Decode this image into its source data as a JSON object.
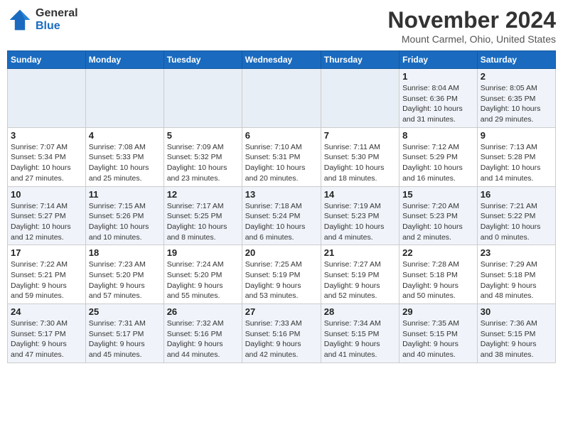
{
  "header": {
    "logo_line1": "General",
    "logo_line2": "Blue",
    "month": "November 2024",
    "location": "Mount Carmel, Ohio, United States"
  },
  "weekdays": [
    "Sunday",
    "Monday",
    "Tuesday",
    "Wednesday",
    "Thursday",
    "Friday",
    "Saturday"
  ],
  "weeks": [
    [
      {
        "day": "",
        "info": ""
      },
      {
        "day": "",
        "info": ""
      },
      {
        "day": "",
        "info": ""
      },
      {
        "day": "",
        "info": ""
      },
      {
        "day": "",
        "info": ""
      },
      {
        "day": "1",
        "info": "Sunrise: 8:04 AM\nSunset: 6:36 PM\nDaylight: 10 hours\nand 31 minutes."
      },
      {
        "day": "2",
        "info": "Sunrise: 8:05 AM\nSunset: 6:35 PM\nDaylight: 10 hours\nand 29 minutes."
      }
    ],
    [
      {
        "day": "3",
        "info": "Sunrise: 7:07 AM\nSunset: 5:34 PM\nDaylight: 10 hours\nand 27 minutes."
      },
      {
        "day": "4",
        "info": "Sunrise: 7:08 AM\nSunset: 5:33 PM\nDaylight: 10 hours\nand 25 minutes."
      },
      {
        "day": "5",
        "info": "Sunrise: 7:09 AM\nSunset: 5:32 PM\nDaylight: 10 hours\nand 23 minutes."
      },
      {
        "day": "6",
        "info": "Sunrise: 7:10 AM\nSunset: 5:31 PM\nDaylight: 10 hours\nand 20 minutes."
      },
      {
        "day": "7",
        "info": "Sunrise: 7:11 AM\nSunset: 5:30 PM\nDaylight: 10 hours\nand 18 minutes."
      },
      {
        "day": "8",
        "info": "Sunrise: 7:12 AM\nSunset: 5:29 PM\nDaylight: 10 hours\nand 16 minutes."
      },
      {
        "day": "9",
        "info": "Sunrise: 7:13 AM\nSunset: 5:28 PM\nDaylight: 10 hours\nand 14 minutes."
      }
    ],
    [
      {
        "day": "10",
        "info": "Sunrise: 7:14 AM\nSunset: 5:27 PM\nDaylight: 10 hours\nand 12 minutes."
      },
      {
        "day": "11",
        "info": "Sunrise: 7:15 AM\nSunset: 5:26 PM\nDaylight: 10 hours\nand 10 minutes."
      },
      {
        "day": "12",
        "info": "Sunrise: 7:17 AM\nSunset: 5:25 PM\nDaylight: 10 hours\nand 8 minutes."
      },
      {
        "day": "13",
        "info": "Sunrise: 7:18 AM\nSunset: 5:24 PM\nDaylight: 10 hours\nand 6 minutes."
      },
      {
        "day": "14",
        "info": "Sunrise: 7:19 AM\nSunset: 5:23 PM\nDaylight: 10 hours\nand 4 minutes."
      },
      {
        "day": "15",
        "info": "Sunrise: 7:20 AM\nSunset: 5:23 PM\nDaylight: 10 hours\nand 2 minutes."
      },
      {
        "day": "16",
        "info": "Sunrise: 7:21 AM\nSunset: 5:22 PM\nDaylight: 10 hours\nand 0 minutes."
      }
    ],
    [
      {
        "day": "17",
        "info": "Sunrise: 7:22 AM\nSunset: 5:21 PM\nDaylight: 9 hours\nand 59 minutes."
      },
      {
        "day": "18",
        "info": "Sunrise: 7:23 AM\nSunset: 5:20 PM\nDaylight: 9 hours\nand 57 minutes."
      },
      {
        "day": "19",
        "info": "Sunrise: 7:24 AM\nSunset: 5:20 PM\nDaylight: 9 hours\nand 55 minutes."
      },
      {
        "day": "20",
        "info": "Sunrise: 7:25 AM\nSunset: 5:19 PM\nDaylight: 9 hours\nand 53 minutes."
      },
      {
        "day": "21",
        "info": "Sunrise: 7:27 AM\nSunset: 5:19 PM\nDaylight: 9 hours\nand 52 minutes."
      },
      {
        "day": "22",
        "info": "Sunrise: 7:28 AM\nSunset: 5:18 PM\nDaylight: 9 hours\nand 50 minutes."
      },
      {
        "day": "23",
        "info": "Sunrise: 7:29 AM\nSunset: 5:18 PM\nDaylight: 9 hours\nand 48 minutes."
      }
    ],
    [
      {
        "day": "24",
        "info": "Sunrise: 7:30 AM\nSunset: 5:17 PM\nDaylight: 9 hours\nand 47 minutes."
      },
      {
        "day": "25",
        "info": "Sunrise: 7:31 AM\nSunset: 5:17 PM\nDaylight: 9 hours\nand 45 minutes."
      },
      {
        "day": "26",
        "info": "Sunrise: 7:32 AM\nSunset: 5:16 PM\nDaylight: 9 hours\nand 44 minutes."
      },
      {
        "day": "27",
        "info": "Sunrise: 7:33 AM\nSunset: 5:16 PM\nDaylight: 9 hours\nand 42 minutes."
      },
      {
        "day": "28",
        "info": "Sunrise: 7:34 AM\nSunset: 5:15 PM\nDaylight: 9 hours\nand 41 minutes."
      },
      {
        "day": "29",
        "info": "Sunrise: 7:35 AM\nSunset: 5:15 PM\nDaylight: 9 hours\nand 40 minutes."
      },
      {
        "day": "30",
        "info": "Sunrise: 7:36 AM\nSunset: 5:15 PM\nDaylight: 9 hours\nand 38 minutes."
      }
    ]
  ]
}
